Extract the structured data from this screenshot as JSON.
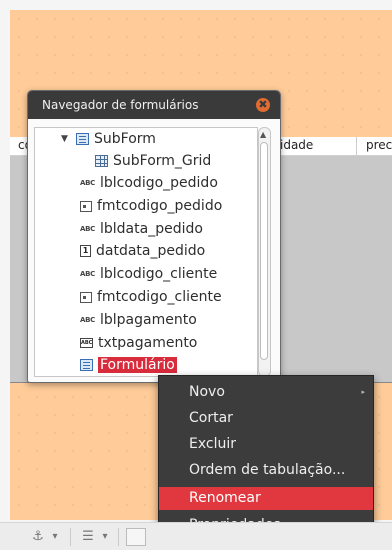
{
  "grid": {
    "columns": [
      "co",
      "idade",
      "prec"
    ]
  },
  "navigator": {
    "title": "Navegador de formulários",
    "close_glyph": "✖",
    "scroll_up_glyph": "▲",
    "items": [
      {
        "label": "SubForm",
        "icon": "form-icon",
        "expander": "▼"
      },
      {
        "label": "SubForm_Grid",
        "icon": "grid-icon"
      },
      {
        "label": "lblcodigo_pedido",
        "icon": "label-icon",
        "icon_text": "ABC"
      },
      {
        "label": "fmtcodigo_pedido",
        "icon": "formatted-field-icon"
      },
      {
        "label": "lbldata_pedido",
        "icon": "label-icon",
        "icon_text": "ABC"
      },
      {
        "label": "datdata_pedido",
        "icon": "date-field-icon",
        "icon_text": "1"
      },
      {
        "label": "lblcodigo_cliente",
        "icon": "label-icon",
        "icon_text": "ABC"
      },
      {
        "label": "fmtcodigo_cliente",
        "icon": "formatted-field-icon"
      },
      {
        "label": "lblpagamento",
        "icon": "label-icon",
        "icon_text": "ABC"
      },
      {
        "label": "txtpagamento",
        "icon": "text-field-icon",
        "icon_text": "ABC"
      },
      {
        "label": "Formulário",
        "icon": "form-icon",
        "selected": true
      }
    ]
  },
  "context_menu": {
    "items": [
      {
        "label": "Novo",
        "submenu": true,
        "arrow": "▸"
      },
      {
        "label": "Cortar"
      },
      {
        "label": "Excluir"
      },
      {
        "label": "Ordem de tabulação..."
      },
      {
        "label": "Renomear",
        "highlighted": true
      },
      {
        "label": "Propriedades"
      }
    ]
  },
  "toolbar": {
    "anchor_glyph": "⚓",
    "dropdown_glyph": "▾",
    "align_glyph": "☰"
  },
  "colors": {
    "canvas": "#ffcc99",
    "selection": "#d82b3b",
    "menu_highlight": "#e0383e",
    "menu_bg": "#3c3c3c",
    "titlebar": "#3a3a3a"
  }
}
